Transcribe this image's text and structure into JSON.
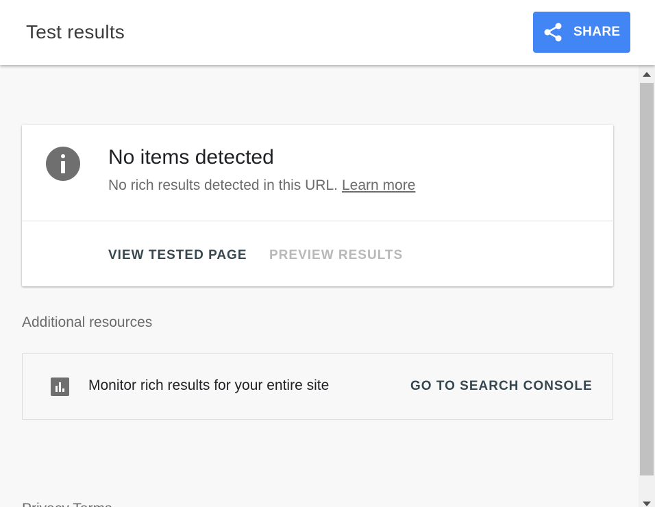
{
  "header": {
    "title": "Test results",
    "share_label": "SHARE",
    "share_icon": "share-icon",
    "share_color": "#4285f4"
  },
  "result_card": {
    "icon": "info-icon",
    "title": "No items detected",
    "subtitle": "No rich results detected in this URL.",
    "learn_more": "Learn more",
    "actions": [
      {
        "label": "VIEW TESTED PAGE",
        "enabled": true
      },
      {
        "label": "PREVIEW RESULTS",
        "enabled": false
      }
    ]
  },
  "additional_resources": {
    "heading": "Additional resources",
    "items": [
      {
        "icon": "bar-chart-icon",
        "text": "Monitor rich results for your entire site",
        "action": "GO TO SEARCH CONSOLE"
      }
    ]
  },
  "footer": {
    "clipped_text": "Privacy    Terms"
  }
}
